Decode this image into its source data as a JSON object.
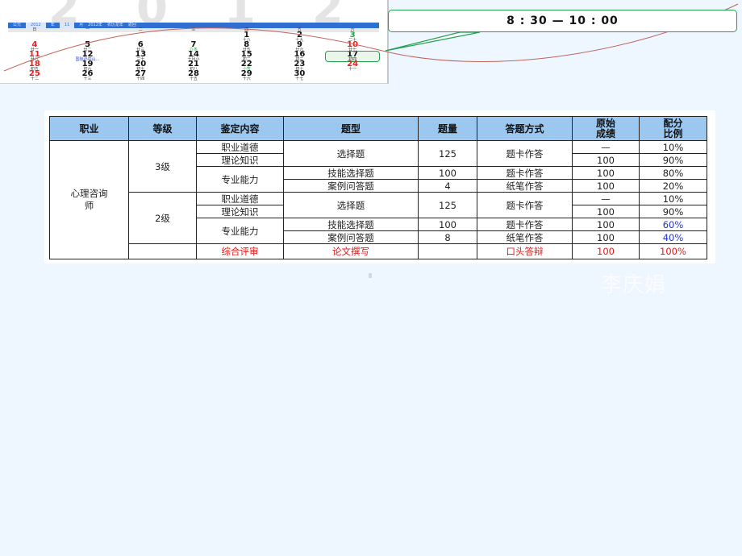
{
  "calendar": {
    "year_banner": "2012",
    "toolbar_items": [
      "公元",
      "2012",
      "年",
      "11",
      "月",
      "2012年",
      "农历龙年",
      "返回"
    ],
    "weekdays": [
      "日",
      "一",
      "二",
      "三",
      "四",
      "五",
      "六"
    ],
    "days": [
      {
        "day": "",
        "lunar": ""
      },
      {
        "day": "",
        "lunar": ""
      },
      {
        "day": "",
        "lunar": ""
      },
      {
        "day": "",
        "lunar": ""
      },
      {
        "day": "1",
        "lunar": "十八"
      },
      {
        "day": "2",
        "lunar": "十九"
      },
      {
        "day": "3",
        "lunar": "二十",
        "color": "green"
      },
      {
        "day": "4",
        "lunar": "廿一",
        "color": "red"
      },
      {
        "day": "5",
        "lunar": "廿二"
      },
      {
        "day": "6",
        "lunar": "廿三"
      },
      {
        "day": "7",
        "lunar": "立冬",
        "lunar_color": "green"
      },
      {
        "day": "8",
        "lunar": "廿五"
      },
      {
        "day": "9",
        "lunar": "廿六"
      },
      {
        "day": "10",
        "lunar": "廿七",
        "color": "red"
      },
      {
        "day": "11",
        "lunar": "廿八",
        "color": "red"
      },
      {
        "day": "12",
        "lunar": "国际孙中山...",
        "lunar_color": "blue"
      },
      {
        "day": "13",
        "lunar": "三十"
      },
      {
        "day": "14",
        "lunar": "十月小"
      },
      {
        "day": "15",
        "lunar": "初二"
      },
      {
        "day": "16",
        "lunar": "初三"
      },
      {
        "day": "17",
        "lunar": "初四",
        "today": true
      },
      {
        "day": "18",
        "lunar": "初五",
        "color": "red"
      },
      {
        "day": "19",
        "lunar": "初六"
      },
      {
        "day": "20",
        "lunar": "初七"
      },
      {
        "day": "21",
        "lunar": "初八"
      },
      {
        "day": "22",
        "lunar": "小雪",
        "lunar_color": "green"
      },
      {
        "day": "23",
        "lunar": "初十"
      },
      {
        "day": "24",
        "lunar": "十一",
        "color": "red"
      },
      {
        "day": "25",
        "lunar": "十二",
        "color": "red"
      },
      {
        "day": "26",
        "lunar": "十三"
      },
      {
        "day": "27",
        "lunar": "十四"
      },
      {
        "day": "28",
        "lunar": "十五"
      },
      {
        "day": "29",
        "lunar": "十六"
      },
      {
        "day": "30",
        "lunar": "十七"
      },
      {
        "day": "",
        "lunar": ""
      }
    ]
  },
  "callout": {
    "time_range": "8 : 30 — 10 : 00"
  },
  "table": {
    "headers": {
      "occupation": "职业",
      "level": "等级",
      "content": "鉴定内容",
      "question_type": "题型",
      "question_count": "题量",
      "answer_method": "答题方式",
      "raw_score": "原始成绩",
      "weight": "配分比例"
    },
    "occupation": "心理咨询师",
    "level3": {
      "level": "3级",
      "ethics": "职业道德",
      "theory": "理论知识",
      "choice": "选择题",
      "choice_count": "125",
      "choice_method": "题卡作答",
      "ethics_score": "—",
      "ethics_weight": "10%",
      "theory_score": "100",
      "theory_weight": "90%",
      "skill": "专业能力",
      "skill_choice": "技能选择题",
      "skill_choice_count": "100",
      "skill_choice_method": "题卡作答",
      "skill_choice_score": "100",
      "skill_choice_weight": "80%",
      "case": "案例问答题",
      "case_count": "4",
      "case_method": "纸笔作答",
      "case_score": "100",
      "case_weight": "20%"
    },
    "level2": {
      "level": "2级",
      "ethics": "职业道德",
      "theory": "理论知识",
      "choice": "选择题",
      "choice_count": "125",
      "choice_method": "题卡作答",
      "ethics_score": "—",
      "ethics_weight": "10%",
      "theory_score": "100",
      "theory_weight": "90%",
      "skill": "专业能力",
      "skill_choice": "技能选择题",
      "skill_choice_count": "100",
      "skill_choice_method": "题卡作答",
      "skill_choice_score": "100",
      "skill_choice_weight": "60%",
      "case": "案例问答题",
      "case_count": "8",
      "case_method": "纸笔作答",
      "case_score": "100",
      "case_weight": "40%",
      "review": "综合评审",
      "review_type": "论文撰写",
      "review_count": "",
      "review_method": "口头答辩",
      "review_score": "100",
      "review_weight": "100%"
    },
    "colors": {
      "header_bg": "#9cc8f0",
      "highlight_red": "#e01818",
      "highlight_blue": "#2233cc"
    }
  },
  "watermark": "李庆娟"
}
